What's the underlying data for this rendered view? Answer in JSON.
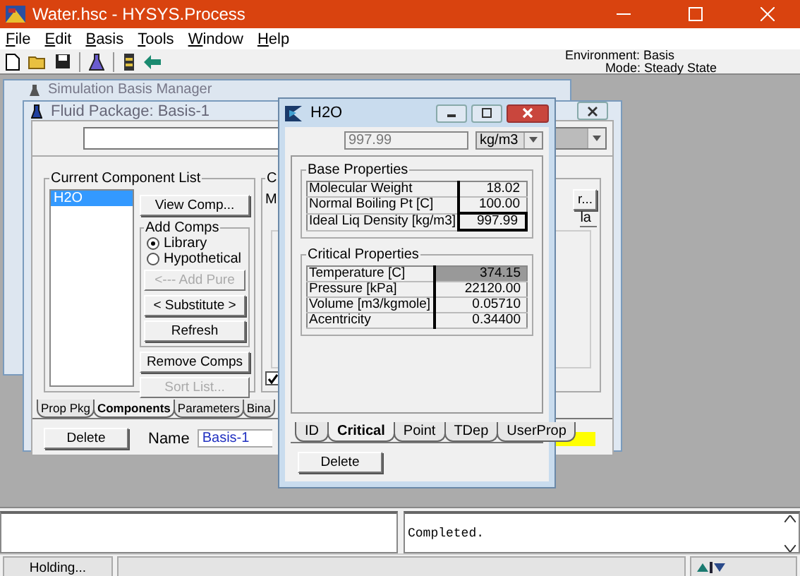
{
  "app_window": {
    "title": "Water.hsc - HYSYS.Process"
  },
  "menu": [
    {
      "label": "File"
    },
    {
      "label": "Edit"
    },
    {
      "label": "Basis"
    },
    {
      "label": "Tools"
    },
    {
      "label": "Window"
    },
    {
      "label": "Help"
    }
  ],
  "environment": {
    "environment": "Environment: Basis",
    "mode": "Mode: Steady State"
  },
  "basis_manager": {
    "title": "Simulation Basis Manager"
  },
  "fluid_package": {
    "title": "Fluid Package: Basis-1",
    "component_group": {
      "title": "Current Component List",
      "components": [
        {
          "name": "H2O",
          "selected": true
        }
      ]
    },
    "view_button": {
      "label": "View Comp...",
      "disabled": false
    },
    "add_comps": {
      "title": "Add Comps",
      "options": [
        {
          "label": "Library",
          "selected": true
        },
        {
          "label": "Hypothetical",
          "selected": false
        }
      ],
      "buttons": [
        {
          "label": "<--- Add Pure",
          "disabled": true
        },
        {
          "label": "< Substitute >",
          "disabled": false
        },
        {
          "label": "Refresh",
          "disabled": false
        }
      ]
    },
    "list_buttons": [
      {
        "label": "Remove Comps",
        "disabled": false
      },
      {
        "label": "Sort List...",
        "disabled": true
      }
    ],
    "side_group": {
      "title": "C",
      "label": "M",
      "button": "r...",
      "column": "la",
      "checked": true
    },
    "tabs": [
      {
        "label": "Prop Pkg",
        "selected": false
      },
      {
        "label": "Components",
        "selected": true
      },
      {
        "label": "Parameters",
        "selected": false
      },
      {
        "label": "Bina",
        "selected": false
      }
    ],
    "delete_button": "Delete",
    "name_label": "Name",
    "name_value": "Basis-1"
  },
  "h2o": {
    "title": "H2O",
    "value_field": {
      "value": "997.99",
      "disabled": true
    },
    "unit": "kg/m3",
    "base": {
      "title": "Base Properties",
      "rows": [
        {
          "label": "Molecular Weight",
          "value": "18.02",
          "focused": false
        },
        {
          "label": "Normal Boiling Pt [C]",
          "value": "100.00",
          "focused": false
        },
        {
          "label": "Ideal Liq Density [kg/m3]",
          "value": "997.99",
          "focused": true
        }
      ]
    },
    "critical": {
      "title": "Critical Properties",
      "rows": [
        {
          "label": "Temperature [C]",
          "value": "374.15",
          "selected": true
        },
        {
          "label": "Pressure [kPa]",
          "value": "22120.00",
          "selected": false
        },
        {
          "label": "Volume [m3/kgmole]",
          "value": "0.05710",
          "selected": false
        },
        {
          "label": "Acentricity",
          "value": "0.34400",
          "selected": false
        }
      ]
    },
    "tabs": [
      {
        "label": "ID",
        "selected": false
      },
      {
        "label": "Critical",
        "selected": true
      },
      {
        "label": "Point",
        "selected": false
      },
      {
        "label": "TDep",
        "selected": false
      },
      {
        "label": "UserProp",
        "selected": false
      }
    ],
    "delete_button": "Delete"
  },
  "message_pane": {
    "text": "Completed."
  },
  "status_bar": {
    "status": "Holding..."
  }
}
